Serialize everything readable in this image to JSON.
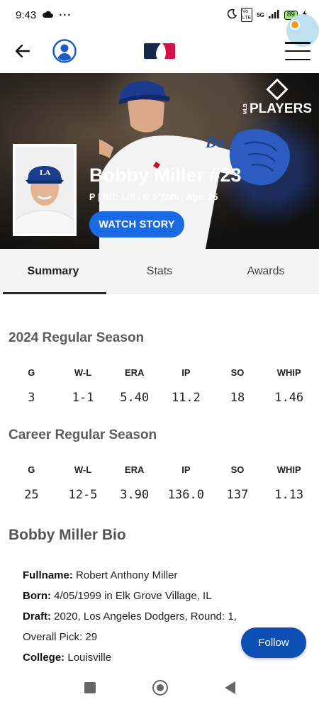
{
  "status_bar": {
    "time": "9:43",
    "network": "5G",
    "battery": "89",
    "icons": [
      "cloud-icon",
      "more-dots-icon",
      "moon-icon",
      "volte-icon",
      "signal-icon",
      "battery-icon",
      "charging-icon"
    ]
  },
  "header": {
    "back_icon": "arrow-left-icon",
    "profile_icon": "user-avatar-icon",
    "logo": "mlb-logo",
    "menu_icon": "hamburger-menu-icon"
  },
  "hero": {
    "brand_text": "PLAYERS",
    "brand_small": "MLB",
    "player_name": "Bobby Miller #23",
    "meta": {
      "position": "P",
      "bt": "B/T: L/R",
      "height_weight": "6' 5\"/220",
      "age": "Age: 25"
    },
    "watch_story_label": "WATCH STORY"
  },
  "tabs": [
    {
      "label": "Summary",
      "active": true
    },
    {
      "label": "Stats",
      "active": false
    },
    {
      "label": "Awards",
      "active": false
    }
  ],
  "season": {
    "title": "2024 Regular Season",
    "headers": [
      "G",
      "W-L",
      "ERA",
      "IP",
      "SO",
      "WHIP"
    ],
    "values": [
      "3",
      "1-1",
      "5.40",
      "11.2",
      "18",
      "1.46"
    ]
  },
  "career": {
    "title": "Career Regular Season",
    "headers": [
      "G",
      "W-L",
      "ERA",
      "IP",
      "SO",
      "WHIP"
    ],
    "values": [
      "25",
      "12-5",
      "3.90",
      "136.0",
      "137",
      "1.13"
    ]
  },
  "bio": {
    "title": "Bobby Miller Bio",
    "fullname_label": "Fullname:",
    "fullname": "Robert Anthony Miller",
    "born_label": "Born:",
    "born": "4/05/1999 in Elk Grove Village, IL",
    "draft_label": "Draft:",
    "draft": "2020, Los Angeles Dodgers, Round: 1, Overall Pick: 29",
    "college_label": "College:",
    "college": "Louisville"
  },
  "follow_label": "Follow",
  "colors": {
    "accent_blue": "#1a6ae6",
    "follow_blue": "#0b4fb3",
    "dodger_blue": "#1e5bc6"
  }
}
